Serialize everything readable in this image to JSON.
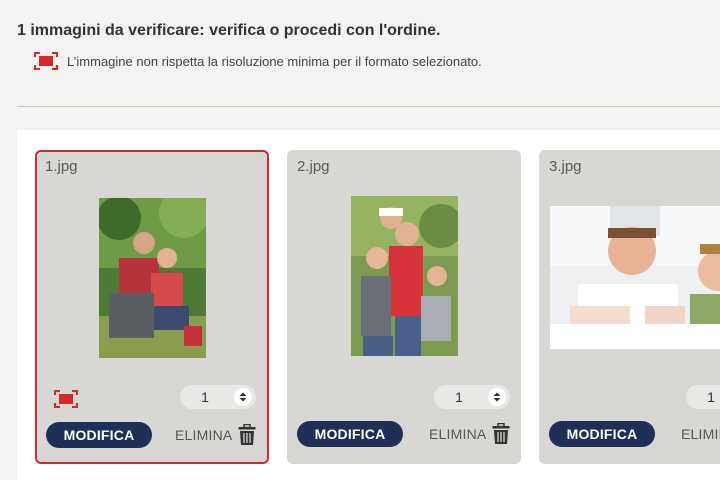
{
  "header": {
    "title": "1 immagini da verificare: verifica o procedi con l'ordine.",
    "warning_text": "L’immagine non rispetta la risoluzione minima per il formato selezionato."
  },
  "cards": [
    {
      "filename": "1.jpg",
      "quantity": "1",
      "has_warning": true,
      "modify_label": "MODIFICA",
      "delete_label": "ELIMINA"
    },
    {
      "filename": "2.jpg",
      "quantity": "1",
      "has_warning": false,
      "modify_label": "MODIFICA",
      "delete_label": "ELIMINA"
    },
    {
      "filename": "3.jpg",
      "quantity": "1",
      "has_warning": false,
      "modify_label": "MODIFICA",
      "delete_label": "ELIMINA"
    }
  ],
  "colors": {
    "error_border": "#d82727",
    "primary_button": "#1f2f57",
    "card_background": "#d9d7d4"
  },
  "icons": {
    "low_resolution": "low-resolution-icon",
    "quantity_stepper": "up-down-arrows-icon",
    "delete": "trash-icon"
  }
}
